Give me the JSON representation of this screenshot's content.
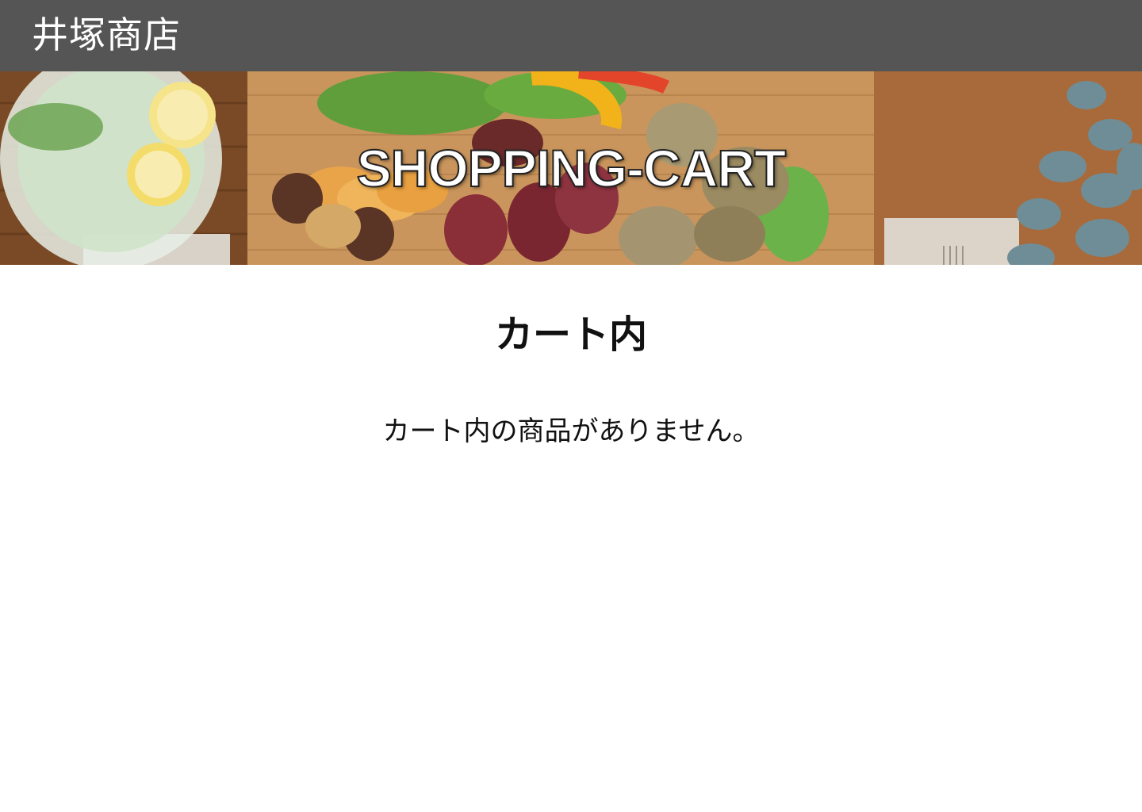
{
  "header": {
    "site_title": "井塚商店",
    "background_color": "#555555"
  },
  "hero": {
    "title": "SHOPPING-CART",
    "image_description_icon": "food-platter-image"
  },
  "main": {
    "heading": "カート内",
    "empty_message": "カート内の商品がありません。"
  }
}
